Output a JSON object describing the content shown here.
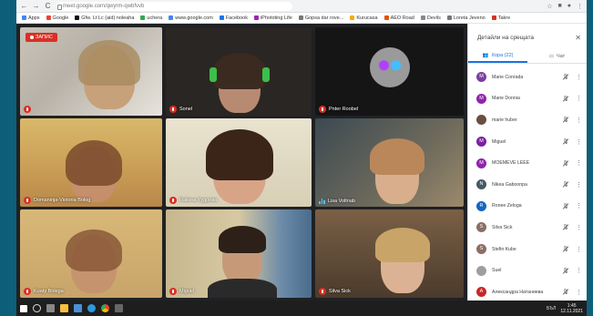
{
  "browser": {
    "url": "meet.google.com/qwyrm-qwbfvvb",
    "nav": {
      "back": "←",
      "forward": "→",
      "reload": "C"
    },
    "bookmarks": [
      {
        "label": "Apps",
        "color": "#4285f4"
      },
      {
        "label": "Google",
        "color": "#ea4335"
      },
      {
        "label": "Gfw. Lt Lc (aid) noleaha",
        "color": "#111111"
      },
      {
        "label": "uchera",
        "color": "#34a853"
      },
      {
        "label": "www.google.com",
        "color": "#4285f4"
      },
      {
        "label": "Facebook",
        "color": "#1877f2"
      },
      {
        "label": "iPhototing Life",
        "color": "#9c27b0"
      },
      {
        "label": "Gopsa dar rove...",
        "color": "#777777"
      },
      {
        "label": "Kurucasa",
        "color": "#f9ab00"
      },
      {
        "label": "AEO Road",
        "color": "#e65100"
      },
      {
        "label": "Devils",
        "color": "#888888"
      },
      {
        "label": "Loreta Jeveno",
        "color": "#777777"
      },
      {
        "label": "Takre",
        "color": "#d93025"
      }
    ]
  },
  "meet": {
    "recording_label": "ЗАПИС",
    "tiles": [
      {
        "name": "",
        "mic": "off"
      },
      {
        "name": "Sonel",
        "mic": "off"
      },
      {
        "name": "Pnter Roobel",
        "mic": "off"
      },
      {
        "name": "Domaninja-Viotoria Bolog",
        "mic": "off"
      },
      {
        "name": "Raliнна Кудрова",
        "mic": "off"
      },
      {
        "name": "Lisa Voltnab",
        "mic": "on"
      },
      {
        "name": "Kuaty Bolega",
        "mic": "off"
      },
      {
        "name": "Miguel",
        "mic": "off"
      },
      {
        "name": "Silva Sick",
        "mic": "off"
      }
    ]
  },
  "panel": {
    "title": "Детайли на срещата",
    "close": "✕",
    "tabs": [
      {
        "label": "Хора (22)",
        "active": true
      },
      {
        "label": "Чат",
        "active": false
      }
    ],
    "participants": [
      {
        "initial": "M",
        "name": "Marie Conrada",
        "color": "#7b3fa0"
      },
      {
        "initial": "M",
        "name": "Marie Donnia",
        "color": "#8e24aa"
      },
      {
        "initial": "",
        "name": "marie huber",
        "color": "#6d4c41"
      },
      {
        "initial": "M",
        "name": "Miguel",
        "color": "#7b1fa2"
      },
      {
        "initial": "M",
        "name": "MOEMEVE LEEE",
        "color": "#8e24aa"
      },
      {
        "initial": "N",
        "name": "Nikea Gaboonpa",
        "color": "#455a64"
      },
      {
        "initial": "R",
        "name": "Ronee Zeloga",
        "color": "#1565c0"
      },
      {
        "initial": "S",
        "name": "Silva Sick",
        "color": "#8d6e63"
      },
      {
        "initial": "S",
        "name": "Stefin Kube",
        "color": "#8d6e63"
      },
      {
        "initial": "",
        "name": "Suel",
        "color": "#9e9e9e"
      },
      {
        "initial": "A",
        "name": "Александра Натаниева",
        "color": "#c62828"
      }
    ]
  },
  "taskbar": {
    "lang": "БЪЛ",
    "time": "1:45",
    "date": "12.11.2021"
  },
  "colors": {
    "meet_bg": "#202124",
    "accent": "#1a73e8",
    "record": "#d93025"
  }
}
